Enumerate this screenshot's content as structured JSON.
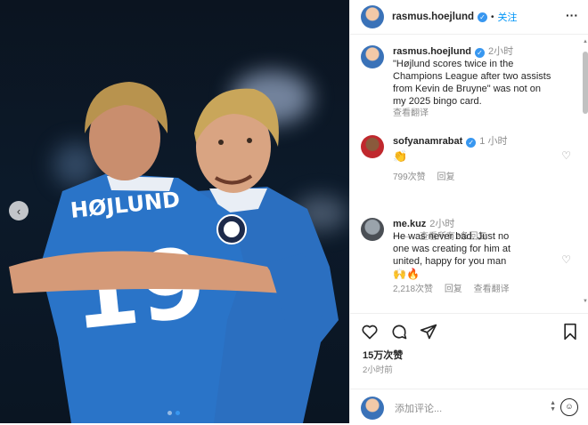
{
  "post": {
    "slide_nav": {
      "prev_icon": "‹"
    },
    "jersey_names": [
      "HØJLUND",
      "19"
    ]
  },
  "header": {
    "username": "rasmus.hoejlund",
    "verified_icon": "✓",
    "follow_label": "关注",
    "more_icon": "···"
  },
  "caption": {
    "username": "rasmus.hoejlund",
    "time": "2小时",
    "text_lines": [
      "\"Højlund scores twice in the",
      "Champions League after two assists",
      "from Kevin de Bruyne\" was not on",
      "my 2025 bingo card."
    ],
    "see_translation": "查看翻译"
  },
  "comments": [
    {
      "username": "sofyanamrabat",
      "time": "1 小时",
      "text": "👏",
      "likes": "799次赞",
      "reply": "回复"
    },
    {
      "username": "me.kuz",
      "time": "2小时",
      "text_lines": [
        "He was never bad. Just no",
        "one was creating for him at",
        "united, happy for you man"
      ],
      "emoji": "🙌🔥",
      "likes": "2,218次赞",
      "reply": "回复",
      "see_translation": "查看翻译"
    }
  ],
  "view_replies": "查看所有2条回复",
  "actions": {
    "likes": "15万次赞",
    "ago": "2小时前"
  },
  "add_comment": {
    "placeholder": "添加评论..."
  }
}
